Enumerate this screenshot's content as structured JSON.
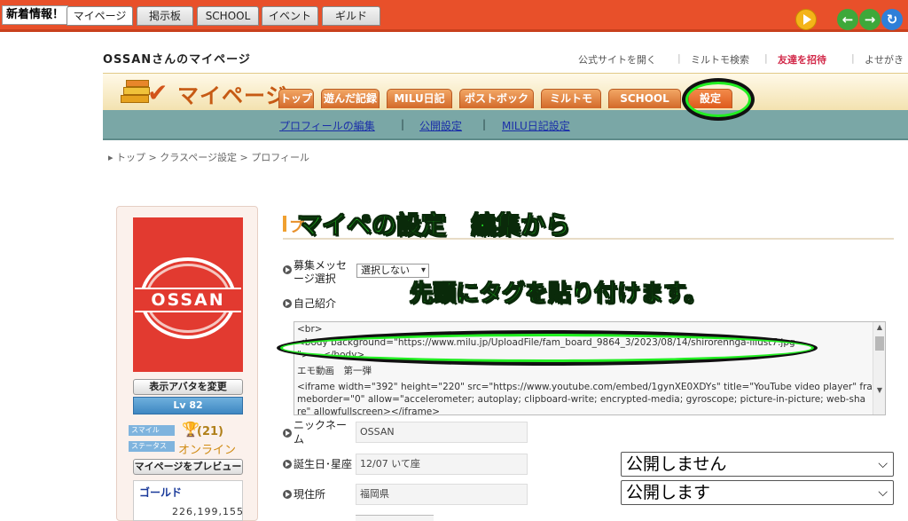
{
  "topbar": {
    "news_label": "新着情報！",
    "tabs": [
      "マイページ",
      "掲示板",
      "SCHOOL",
      "イベント",
      "ギルド"
    ]
  },
  "header": {
    "owner_name": "OSSAN",
    "owner_suffix": "さんのマイページ",
    "links": [
      "公式サイトを開く",
      "ミルトモ検索",
      "友達を招待",
      "よせがき"
    ]
  },
  "banner": {
    "title": "マイページ",
    "tabs": [
      "トップ",
      "遊んだ記録",
      "MILU日記",
      "ポストボックス",
      "ミルトモ",
      "SCHOOL",
      "設定"
    ]
  },
  "subnav": {
    "links": [
      "プロフィールの編集",
      "公開設定",
      "MILU日記設定"
    ],
    "separator": "|"
  },
  "breadcrumb": "▸ トップ > クラスページ設定 > プロフィール",
  "profile": {
    "avatar_logo": "OSSAN",
    "change_avatar_label": "表示アバタを変更",
    "level": "Lv 82",
    "badge_style": "スマイル",
    "badge_status": "ステータス",
    "trophy_count": "(21)",
    "online_status": "オンライン",
    "preview_label": "マイページをプレビュー",
    "gold_label": "ゴールド",
    "gold_value": "226,199,155"
  },
  "form": {
    "section_title_visible": "プ",
    "recruit_label": "募集メッセージ選択",
    "recruit_value": "選択しない",
    "intro_label": "自己紹介",
    "intro_lines": [
      "<br>",
      "<body background=\"https://www.milu.jp/UploadFile/fam_board_9864_3/2023/08/14/shirorennga-illust7.jpg",
      "\"> ~ </body>",
      "エモ動画　第一弾",
      "<iframe width=\"392\" height=\"220\" src=\"https://www.youtube.com/embed/1gynXE0XDYs\" title=\"YouTube video player\" fra",
      "meborder=\"0\" allow=\"accelerometer; autoplay; clipboard-write; encrypted-media; gyroscope; picture-in-picture; web-sha",
      "re\" allowfullscreen></iframe>"
    ],
    "nickname_label_1": "ニックネー",
    "nickname_label_2": "ム",
    "nickname_value": "OSSAN",
    "birthday_label": "誕生日･星座",
    "birthday_value": "12/07 いて座",
    "location_label": "現住所",
    "location_value": "福岡県",
    "visibility_birthday": "公開しません",
    "visibility_location": "公開します"
  },
  "annotations": {
    "caption_1": "マイペの設定　編集から",
    "caption_2": "先頭にタグを貼り付けます。"
  },
  "colors": {
    "topbar": "#e8502a",
    "nav_tab": "#d36a2a",
    "subnav": "#7aa7a6",
    "annotation": "#22ee22"
  }
}
